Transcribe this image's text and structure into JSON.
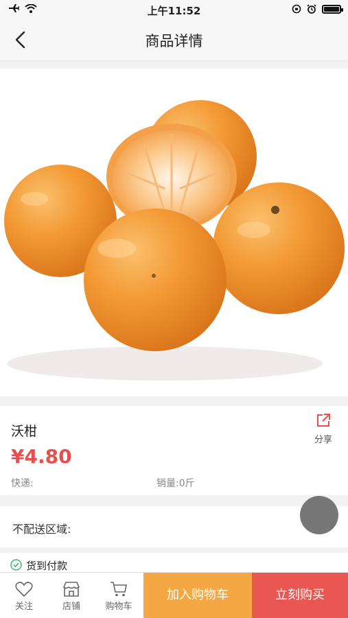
{
  "status_bar": {
    "time": "上午11:52"
  },
  "header": {
    "title": "商品详情"
  },
  "product": {
    "name": "沃柑",
    "price": "¥4.80",
    "shipping_label": "快递:",
    "sales_label": "销量:0斤",
    "share_label": "分享"
  },
  "delivery": {
    "region_label": "不配送区域:"
  },
  "services": {
    "cod_label": "货到付款"
  },
  "bottom_bar": {
    "follow": "关注",
    "store": "店铺",
    "cart": "购物车",
    "add_to_cart": "加入购物车",
    "buy_now": "立刻购买"
  },
  "colors": {
    "price": "#e84e4e",
    "add_to_cart_bg": "#f4a742",
    "buy_now_bg": "#ea5651",
    "orange": "#f29a3a"
  }
}
